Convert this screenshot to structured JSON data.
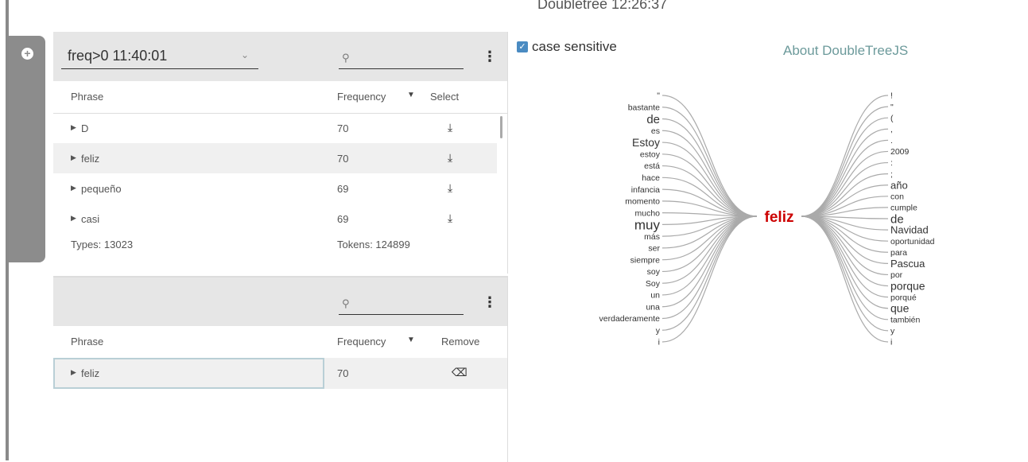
{
  "app_title": "Doubletree 12:26:37",
  "side_panel": {
    "add_icon": "plus-circle-icon"
  },
  "top_panel": {
    "dropdown_value": "freq>0 11:40:01",
    "search_placeholder": "",
    "columns": {
      "phrase": "Phrase",
      "frequency": "Frequency",
      "select": "Select"
    },
    "rows": [
      {
        "phrase": "D",
        "frequency": "70"
      },
      {
        "phrase": "feliz",
        "frequency": "70"
      },
      {
        "phrase": "pequeño",
        "frequency": "69"
      },
      {
        "phrase": "casi",
        "frequency": "69"
      }
    ],
    "types": "Types: 13023",
    "tokens": "Tokens: 124899"
  },
  "bottom_panel": {
    "columns": {
      "phrase": "Phrase",
      "frequency": "Frequency",
      "remove": "Remove"
    },
    "rows": [
      {
        "phrase": "feliz",
        "frequency": "70"
      }
    ]
  },
  "visualization": {
    "case_sensitive_label": "case sensitive",
    "about_link": "About DoubleTreeJS",
    "center_word": "feliz",
    "center_color": "#cc0000",
    "left_words": [
      "\"",
      "bastante",
      "de",
      "es",
      "Estoy",
      "estoy",
      "está",
      "hace",
      "infancia",
      "momento",
      "mucho",
      "muy",
      "más",
      "ser",
      "siempre",
      "soy",
      "Soy",
      "un",
      "una",
      "verdaderamente",
      "y",
      "i"
    ],
    "right_words": [
      "!",
      "\"",
      "(",
      ",",
      ".",
      "2009",
      ":",
      ";",
      "año",
      "con",
      "cumple",
      "de",
      "Navidad",
      "oportunidad",
      "para",
      "Pascua",
      "por",
      "porque",
      "porqué",
      "que",
      "también",
      "y",
      "i"
    ]
  }
}
